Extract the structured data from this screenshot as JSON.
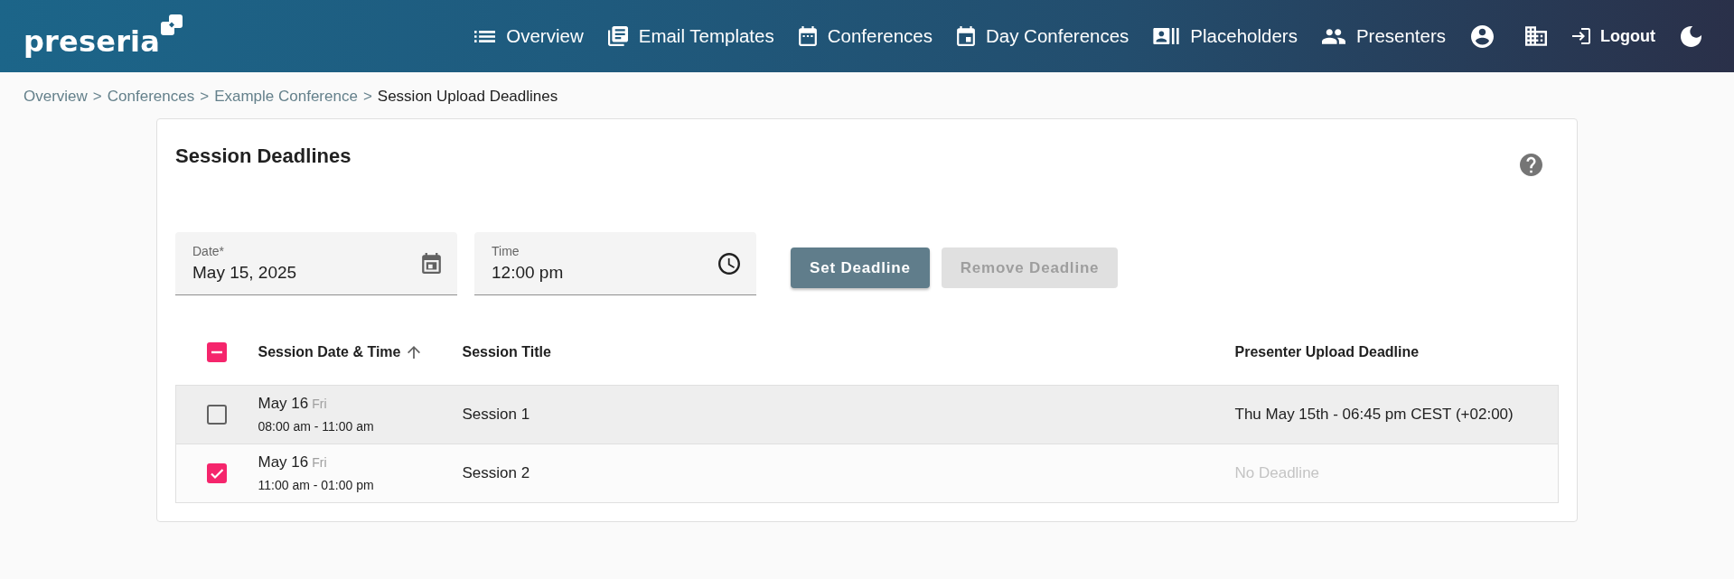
{
  "navbar": {
    "logo": "preseria",
    "links": [
      "Overview",
      "Email Templates",
      "Conferences",
      "Day Conferences",
      "Placeholders",
      "Presenters"
    ],
    "logout": "Logout"
  },
  "breadcrumb": [
    {
      "kind": "link",
      "label": "Overview"
    },
    {
      "kind": "separator",
      "label": ">"
    },
    {
      "kind": "link",
      "label": "Conferences"
    },
    {
      "kind": "separator",
      "label": ">"
    },
    {
      "kind": "link",
      "label": "Example Conference"
    },
    {
      "kind": "separator",
      "label": ">"
    },
    {
      "kind": "current",
      "label": "Session Upload Deadlines"
    }
  ],
  "card": {
    "title": "Session Deadlines",
    "fields": [
      {
        "kind": "date",
        "label": "Date*",
        "value": "May 15, 2025"
      },
      {
        "kind": "time",
        "label": "Time",
        "value": "12:00 pm"
      }
    ],
    "buttons": [
      {
        "label": "Set Deadline",
        "disabled": false
      },
      {
        "label": "Remove Deadline",
        "disabled": true
      }
    ],
    "table": {
      "select_all": {
        "checked": true,
        "indeterminate": true
      },
      "columns": [
        {
          "label": "Session Date & Time",
          "sorted": true
        },
        {
          "label": "Session Title",
          "sorted": false
        },
        {
          "label": "Presenter Upload Deadline",
          "sorted": false
        }
      ],
      "rows": [
        {
          "checked": false,
          "highlighted": true,
          "date": "May 16",
          "weekday": "Fri",
          "time": "08:00 am - 11:00 am",
          "title": "Session 1",
          "deadline": "Thu May 15th - 06:45 pm CEST (+02:00)",
          "deadline_set": true
        },
        {
          "checked": true,
          "highlighted": false,
          "date": "May 16",
          "weekday": "Fri",
          "time": "11:00 am - 01:00 pm",
          "title": "Session 2",
          "deadline": "No Deadline",
          "deadline_set": false
        }
      ]
    }
  }
}
